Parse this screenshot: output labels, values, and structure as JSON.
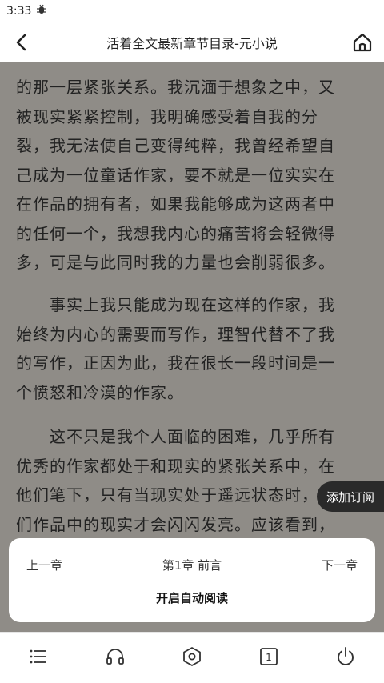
{
  "status": {
    "time": "3:33",
    "notification_icon": "bug-icon"
  },
  "nav": {
    "title": "活着全文最新章节目录-元小说",
    "back_icon": "back-arrow-icon",
    "home_icon": "home-icon"
  },
  "reader": {
    "paragraphs": [
      [
        "的那一层紧张关系。我沉湎于想象之中，又",
        "被现实紧紧控制，我明确感受着自我的分",
        "裂，我无法使自己变得纯粹，我曾经希望自",
        "己成为一位童话作家，要不就是一位实实在",
        "在作品的拥有者，如果我能够成为这两者中",
        "的任何一个，我想我内心的痛苦将会轻微得",
        "多，可是与此同时我的力量也会削弱很多。"
      ],
      [
        "　　事实上我只能成为现在这样的作家，我",
        "始终为内心的需要而写作，理智代替不了我",
        "的写作，正因为此，我在很长一段时间是一",
        "个愤怒和冷漠的作家。"
      ],
      [
        "　　这不只是我个人面临的困难，几乎所有",
        "优秀的作家都处于和现实的紧张关系中，在",
        "他们笔下，只有当现实处于遥远状态时，他",
        "们作品中的现实才会闪闪发亮。应该看到，"
      ]
    ]
  },
  "subscribe": {
    "label": "添加订阅"
  },
  "panel": {
    "prev_label": "上一章",
    "chapter_label": "第1章 前言",
    "next_label": "下一章",
    "auto_read_label": "开启自动阅读"
  },
  "toolbar": {
    "items": [
      "menu-list-icon",
      "headphones-icon",
      "settings-hexagon-icon",
      "page-number-icon",
      "power-icon"
    ],
    "page_number_glyph": "1"
  }
}
